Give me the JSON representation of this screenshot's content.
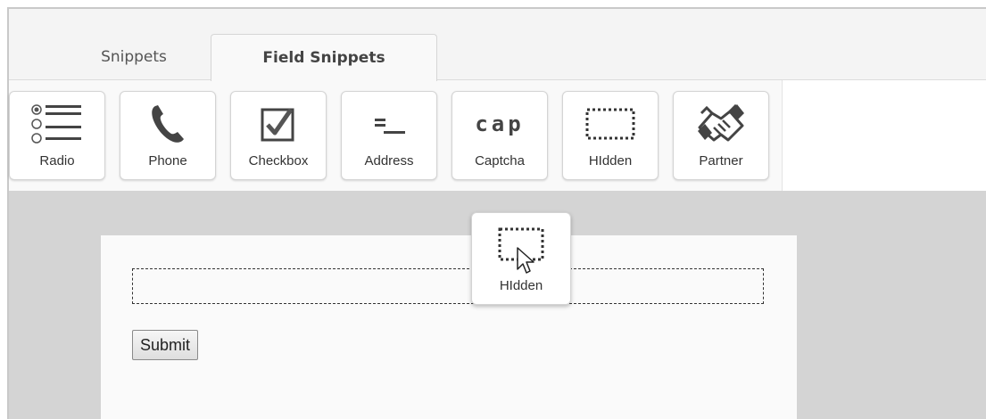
{
  "tabs": [
    {
      "label": "Snippets",
      "active": false
    },
    {
      "label": "Field Snippets",
      "active": true
    }
  ],
  "toolbar": {
    "items": [
      {
        "label": "Radio",
        "icon": "radio-list-icon"
      },
      {
        "label": "Phone",
        "icon": "phone-icon"
      },
      {
        "label": "Checkbox",
        "icon": "checkbox-icon"
      },
      {
        "label": "Address",
        "icon": "address-icon"
      },
      {
        "label": "Captcha",
        "icon": "captcha-icon"
      },
      {
        "label": "HIdden",
        "icon": "hidden-field-icon"
      },
      {
        "label": "Partner",
        "icon": "handshake-icon"
      }
    ],
    "captcha_glyph": "cap"
  },
  "form": {
    "submit_label": "Submit"
  },
  "dragging": {
    "label": "HIdden",
    "icon": "hidden-field-icon"
  },
  "colors": {
    "canvas": "#d4d4d4",
    "toolbar": "#f9f9f9",
    "icon": "#444444"
  }
}
